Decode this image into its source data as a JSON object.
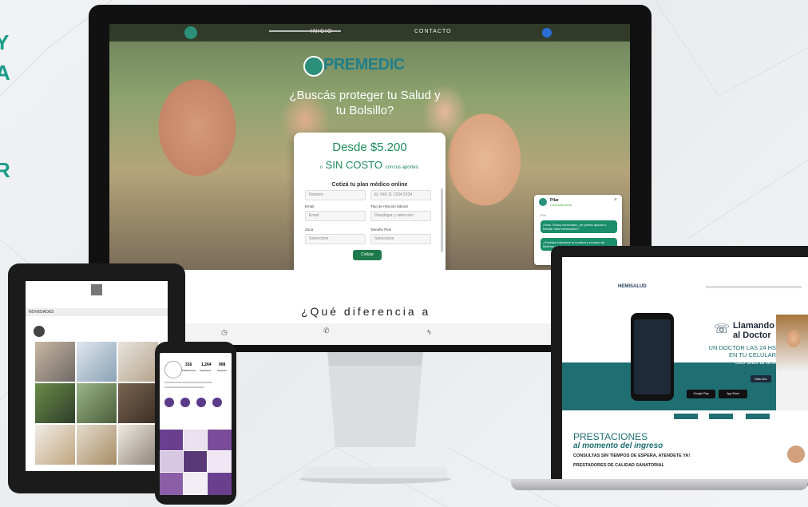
{
  "monitor": {
    "nav": {
      "links": [
        "INICIO",
        "CONTACTO"
      ]
    },
    "brand": "PREMEDIC",
    "tagline": "¿Buscás proteger tu Salud y tu Bolsillo?",
    "card": {
      "price": "Desde $5.200",
      "free_prefix": "o",
      "free_main": "SIN COSTO",
      "free_suffix": "con tus aportes.",
      "form_title": "Cotizá tu plan médico online",
      "fields": {
        "name_placeholder": "Nombre",
        "phone_placeholder": "Ej: 549 11 1234 5234",
        "email_label": "Email",
        "email_placeholder": "Email",
        "relation_label": "Tipo de relación laboral",
        "relation_value": "Desplegar y seleccion",
        "zone_label": "Zona",
        "zone_value": "Seleccione",
        "size_label": "Tamaño Plan",
        "size_value": "Seleccione"
      },
      "submit": "Cotizar"
    },
    "chat": {
      "name": "Pilar",
      "status": "Conectada ahora",
      "sender": "Pilar",
      "msg1": "¡Hola ! Estoy conectada, ¿te puedo ayudar o brindar más información?",
      "msg2": "¿Podrías indicarme tu nombre y número de teléfono por favor?"
    },
    "heading": "¿Qué diferencia a"
  },
  "laptop": {
    "brand": "HEMISALUD",
    "title_line1": "Llamando",
    "title_line2": "al Doctor",
    "sub1": "UN DOCTOR LAS 24 HS",
    "sub2": "EN TU CELULAR",
    "sub3": "365 días al año",
    "cta": "Más info",
    "store1": "Google Play",
    "store2": "App Store",
    "prestaciones": "PRESTACIONES",
    "moment": "al momento del ingreso",
    "bullet1": "CONSULTAS SIN TIEMPOS DE ESPERA, ATENDETE YA!",
    "bullet2": "PRESTADORES DE CALIDAD SANATORIAL"
  },
  "tablet": {
    "section": "NOVEDADES"
  },
  "phone": {
    "stats": [
      "316",
      "1,264",
      "908"
    ],
    "stat_labels": [
      "Publicaciones",
      "Seguidores",
      "Seguidos"
    ]
  },
  "edge_letters": [
    "Y",
    "A",
    "R"
  ],
  "colors": {
    "teal": "#1a9c8a",
    "green": "#1d8a5a",
    "dark": "#1b1b1b"
  }
}
